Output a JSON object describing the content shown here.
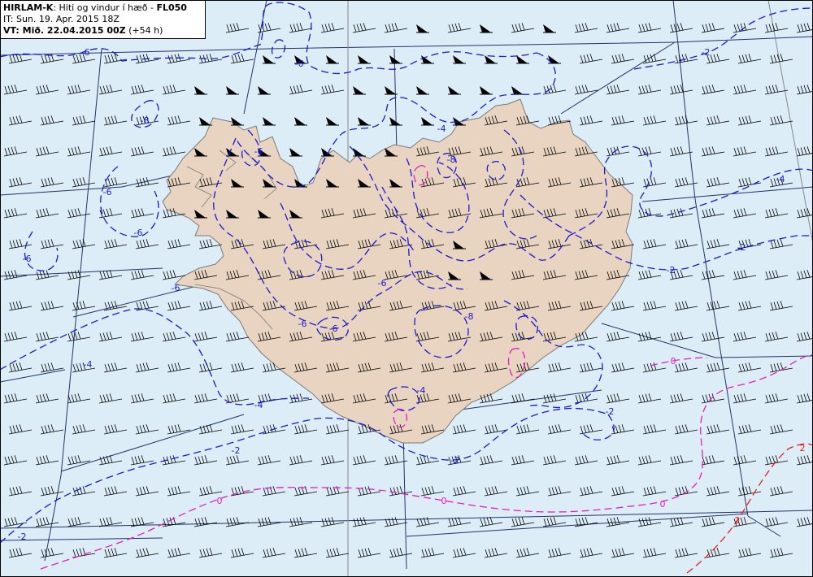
{
  "header": {
    "model": "HIRLAM-K",
    "desc": ": Hiti og vindur í hæð - ",
    "level": "FL050",
    "it": "IT: Sun. 19. Apr. 2015 18Z",
    "vt_label": "VT: Mið. 22.04.2015 00Z",
    "vt_offset": " (+54 h)"
  },
  "colors": {
    "sea": "#dcedf8",
    "land": "#e8d4c0",
    "coast": "#7a7a7a",
    "grid": "#223366",
    "neg_contour": "#1a1ad0",
    "zero_contour": "#e020c0",
    "pos_contour": "#e02020",
    "barb": "#000000"
  },
  "contour_labels": [
    {
      "text": "-6"
    },
    {
      "text": "-6"
    },
    {
      "text": "-8"
    },
    {
      "text": "-6"
    },
    {
      "text": "-6"
    },
    {
      "text": "-6"
    },
    {
      "text": "-6"
    },
    {
      "text": "-6"
    },
    {
      "text": "-6"
    },
    {
      "text": "-6"
    },
    {
      "text": "-6"
    },
    {
      "text": "-4"
    },
    {
      "text": "-4"
    },
    {
      "text": "-4"
    },
    {
      "text": "-4"
    },
    {
      "text": "-2"
    },
    {
      "text": "-2"
    },
    {
      "text": "-2"
    },
    {
      "text": "-2"
    },
    {
      "text": "-2"
    },
    {
      "text": "-2"
    },
    {
      "text": "-2"
    },
    {
      "text": "-8"
    },
    {
      "text": "-8"
    },
    {
      "text": "-4"
    },
    {
      "text": "0"
    },
    {
      "text": "0"
    },
    {
      "text": "0"
    },
    {
      "text": "0"
    },
    {
      "text": "2"
    },
    {
      "text": "2"
    }
  ]
}
